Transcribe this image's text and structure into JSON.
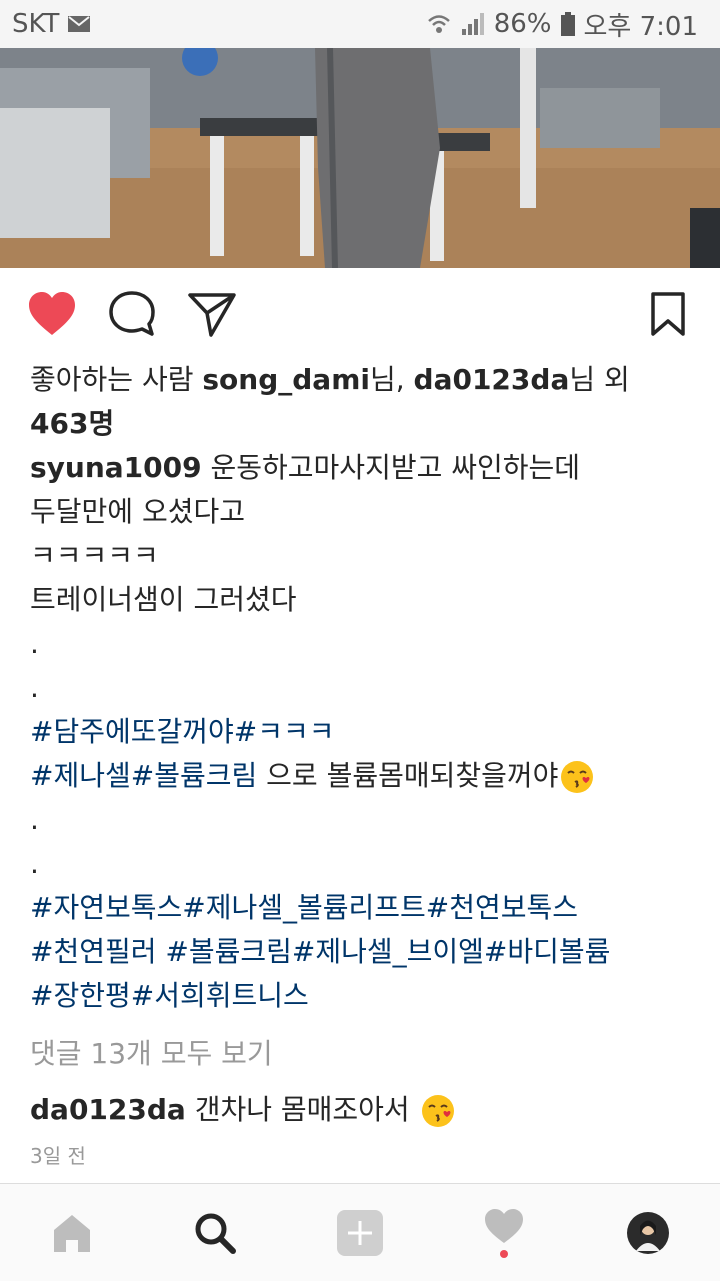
{
  "status_bar": {
    "carrier": "SKT",
    "battery": "86%",
    "time": "오후 7:01"
  },
  "post": {
    "liked": true,
    "likes": {
      "prefix": "좋아하는 사람 ",
      "user1": "song_dami",
      "suffix1": "님, ",
      "user2": "da0123da",
      "suffix2": "님 외",
      "count": "463명"
    },
    "caption": {
      "username": "syuna1009",
      "line1_rest": " 운동하고마사지받고  싸인하는데",
      "line2": "두달만에 오셨다고",
      "line3": "ㅋㅋㅋㅋㅋ",
      "line4": "트레이너샘이 그러셨다",
      "dot": ".",
      "hashtags1": "#담주에또갈꺼야#ㅋㅋㅋ",
      "hashtags2": "#제나셀#볼륨크림",
      "line_text": " 으로 볼륨몸매되찾을꺼야",
      "hashtags3": "#자연보톡스#제나셀_볼륨리프트#천연보톡스",
      "hashtags4": "#천연필러 #볼륨크림#제나셀_브이엘#바디볼륨",
      "hashtags5": "#장한평#서희휘트니스"
    },
    "view_comments": "댓글 13개 모두 보기",
    "comment": {
      "username": "da0123da",
      "text": " 갠차나 몸매조아서 "
    },
    "timestamp": "3일 전"
  },
  "colors": {
    "heart": "#ed4956",
    "hashtag": "#003569",
    "muted": "#999999"
  }
}
